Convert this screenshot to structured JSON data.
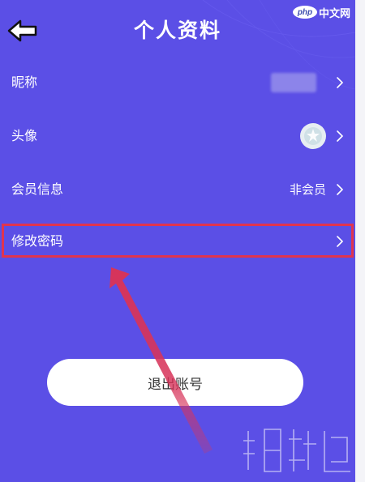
{
  "colors": {
    "background": "#5b4fe6",
    "highlight_border": "#e0344f",
    "arrow": "#d7345a",
    "button_bg": "#ffffff"
  },
  "header": {
    "title": "个人资料",
    "back_icon": "back-arrow-icon"
  },
  "rows": [
    {
      "label": "昵称",
      "value": "",
      "chevron_icon": "chevron-right-icon"
    },
    {
      "label": "头像",
      "value": "",
      "chevron_icon": "chevron-right-icon"
    },
    {
      "label": "会员信息",
      "value": "非会员",
      "chevron_icon": "chevron-right-icon"
    },
    {
      "label": "修改密码",
      "value": "",
      "chevron_icon": "chevron-right-icon"
    }
  ],
  "logout": {
    "label": "退出账号"
  },
  "watermark": {
    "logo": "php",
    "text": "中文网"
  }
}
